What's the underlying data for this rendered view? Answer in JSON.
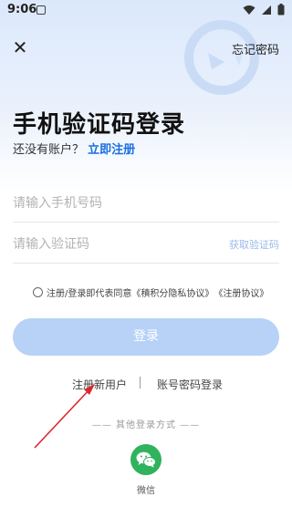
{
  "status_bar": {
    "time": "9:06"
  },
  "header": {
    "forgot_password": "忘记密码"
  },
  "title": "手机验证码登录",
  "subtitle": {
    "prefix": "还没有账户？",
    "register": "立即注册"
  },
  "form": {
    "phone_placeholder": "请输入手机号码",
    "code_placeholder": "请输入验证码",
    "get_code": "获取验证码"
  },
  "agreement": {
    "text": "注册/登录即代表同意",
    "privacy": "《積积分隐私协议》",
    "terms": "《注册协议》"
  },
  "login_button": "登录",
  "links": {
    "register_new": "注册新用户",
    "password_login": "账号密码登录"
  },
  "other_login": {
    "label": "—— 其他登录方式 ——",
    "wechat": "微信"
  },
  "colors": {
    "accent": "#1a6fe0",
    "button": "#b7d2f6",
    "wechat": "#2fb35c",
    "arrow": "#d9272e"
  }
}
